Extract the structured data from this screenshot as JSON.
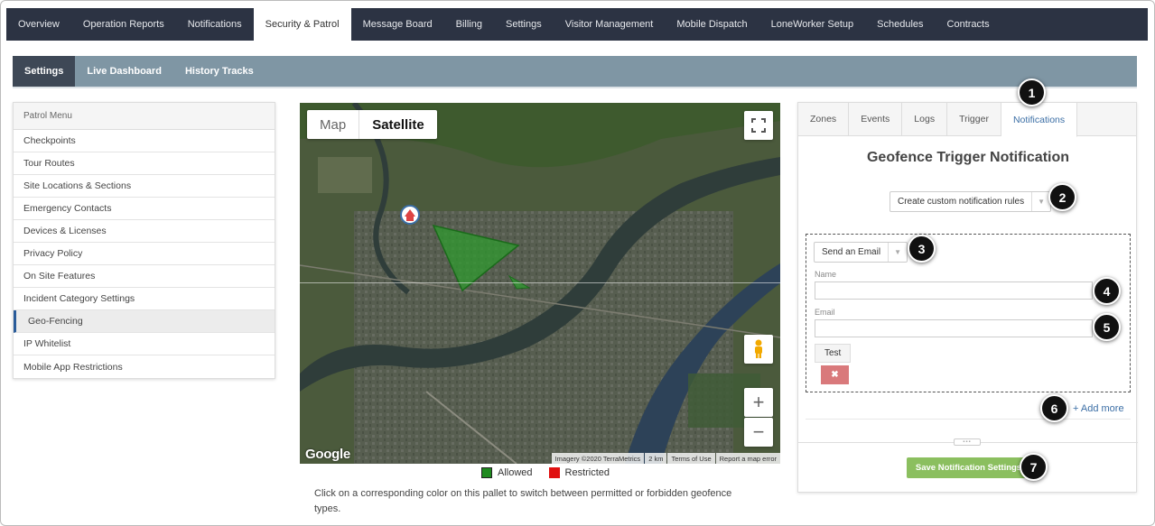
{
  "topnav": {
    "items": [
      "Overview",
      "Operation Reports",
      "Notifications",
      "Security & Patrol",
      "Message Board",
      "Billing",
      "Settings",
      "Visitor Management",
      "Mobile Dispatch",
      "LoneWorker Setup",
      "Schedules",
      "Contracts"
    ],
    "active": "Security & Patrol"
  },
  "subnav": {
    "items": [
      "Settings",
      "Live Dashboard",
      "History Tracks"
    ],
    "active": "Settings"
  },
  "patrol_menu": {
    "title": "Patrol Menu",
    "items": [
      "Checkpoints",
      "Tour Routes",
      "Site Locations & Sections",
      "Emergency Contacts",
      "Devices & Licenses",
      "Privacy Policy",
      "On Site Features",
      "Incident Category Settings",
      "Geo-Fencing",
      "IP Whitelist",
      "Mobile App Restrictions"
    ],
    "active": "Geo-Fencing"
  },
  "map": {
    "type_map": "Map",
    "type_satellite": "Satellite",
    "selected_type": "Satellite",
    "google_label": "Google",
    "attribution": [
      "Imagery ©2020 TerraMetrics",
      "2 km",
      "Terms of Use",
      "Report a map error"
    ],
    "zoom_in": "+",
    "zoom_out": "−"
  },
  "legend": {
    "allowed": "Allowed",
    "restricted": "Restricted",
    "allowed_color": "#1f8a1f",
    "restricted_color": "#e01010"
  },
  "note": "Click on a corresponding color on this pallet to switch between permitted or forbidden geofence types.",
  "panel": {
    "tabs": [
      "Zones",
      "Events",
      "Logs",
      "Trigger",
      "Notifications"
    ],
    "active_tab": "Notifications",
    "title": "Geofence Trigger Notification",
    "rule_select": "Create custom notification rules",
    "action_select": "Send an Email",
    "name_label": "Name",
    "name_value": "",
    "email_label": "Email",
    "email_value": "",
    "test_button": "Test",
    "delete_button": "✖",
    "add_more": "+ Add more",
    "save_button": "Save Notification Settings"
  },
  "callouts": [
    "1",
    "2",
    "3",
    "4",
    "5",
    "6",
    "7"
  ],
  "colors": {
    "topnav_bg": "#2c3343",
    "subnav_bg": "#7f96a4",
    "accent": "#3b6ea5",
    "save_green": "#8bbf5f",
    "delete_red": "#d9797b"
  }
}
